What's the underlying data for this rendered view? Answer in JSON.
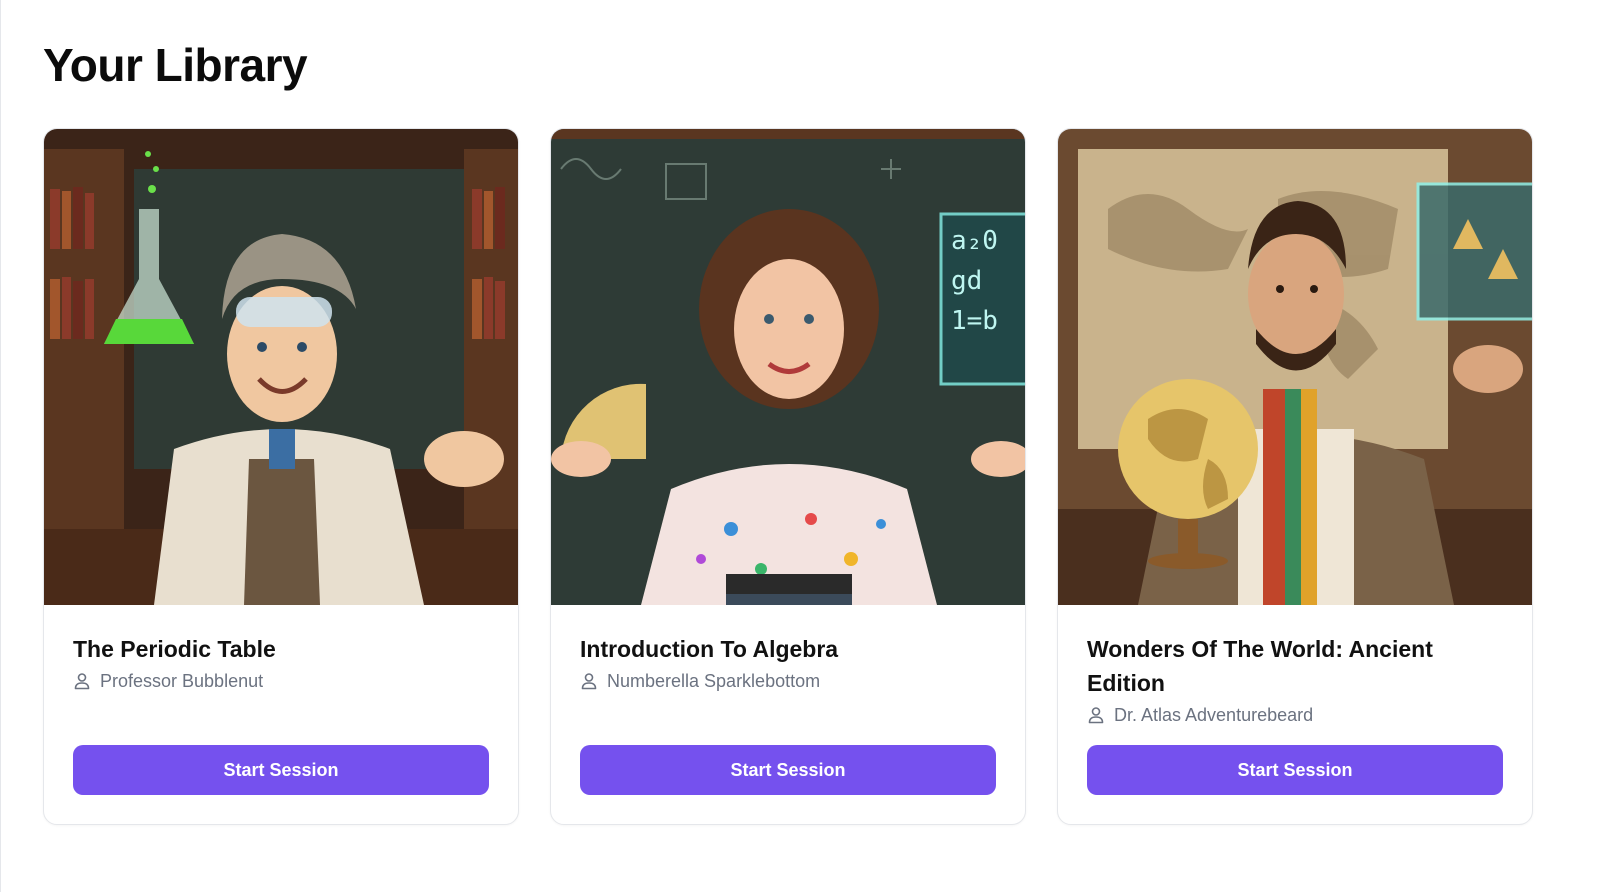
{
  "page": {
    "title": "Your Library"
  },
  "colors": {
    "accent": "#7551ee",
    "muted_text": "#6b7280"
  },
  "courses": [
    {
      "title": "The Periodic Table",
      "author": "Professor Bubblenut",
      "author_icon": "user-icon",
      "button_label": "Start Session",
      "image": "scientist-with-flask-illustration"
    },
    {
      "title": "Introduction To Algebra",
      "author": "Numberella Sparklebottom",
      "author_icon": "user-icon",
      "button_label": "Start Session",
      "image": "math-teacher-at-chalkboard-illustration"
    },
    {
      "title": "Wonders Of The World: Ancient Edition",
      "author": "Dr. Atlas Adventurebeard",
      "author_icon": "user-icon",
      "button_label": "Start Session",
      "image": "explorer-with-globe-illustration"
    }
  ]
}
